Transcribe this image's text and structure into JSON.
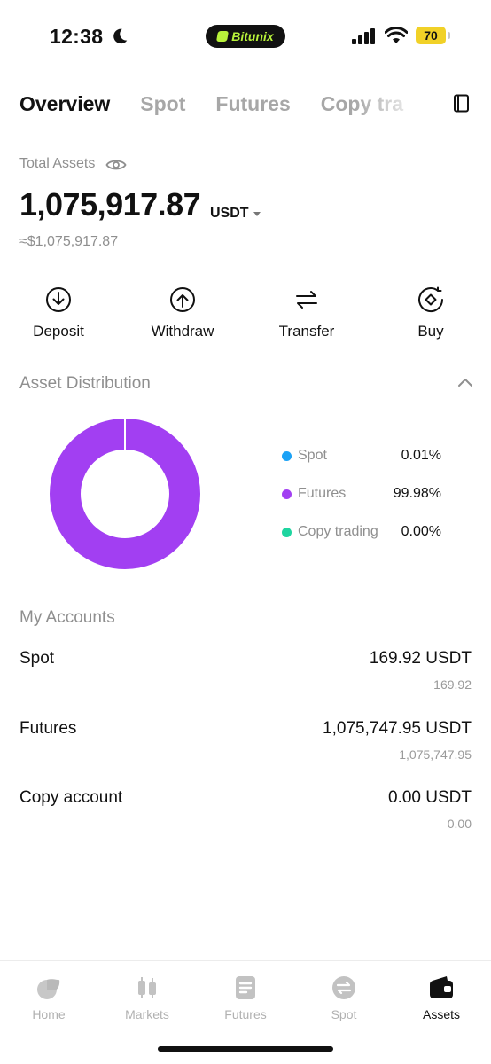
{
  "status": {
    "time": "12:38",
    "island_text": "Bitunix",
    "battery": "70"
  },
  "tabs": [
    {
      "label": "Overview",
      "active": true
    },
    {
      "label": "Spot"
    },
    {
      "label": "Futures"
    },
    {
      "label": "Copy tra"
    }
  ],
  "total": {
    "label": "Total Assets",
    "value": "1,075,917.87",
    "unit": "USDT",
    "fiat": "≈$1,075,917.87"
  },
  "actions": [
    {
      "label": "Deposit",
      "icon": "deposit-icon"
    },
    {
      "label": "Withdraw",
      "icon": "withdraw-icon"
    },
    {
      "label": "Transfer",
      "icon": "transfer-icon"
    },
    {
      "label": "Buy",
      "icon": "buy-icon"
    }
  ],
  "distribution": {
    "title": "Asset Distribution",
    "items": [
      {
        "name": "Spot",
        "value": "0.01%",
        "color": "#1ba2f6"
      },
      {
        "name": "Futures",
        "value": "99.98%",
        "color": "#a23ff2"
      },
      {
        "name": "Copy trading",
        "value": "0.00%",
        "color": "#1fd5a0"
      }
    ],
    "donut_color": "#a23ff2"
  },
  "accounts": {
    "title": "My Accounts",
    "items": [
      {
        "name": "Spot",
        "value": "169.92 USDT",
        "sub": "169.92"
      },
      {
        "name": "Futures",
        "value": "1,075,747.95 USDT",
        "sub": "1,075,747.95"
      },
      {
        "name": "Copy account",
        "value": "0.00 USDT",
        "sub": "0.00"
      }
    ]
  },
  "nav": [
    {
      "label": "Home",
      "icon": "home-icon"
    },
    {
      "label": "Markets",
      "icon": "markets-icon"
    },
    {
      "label": "Futures",
      "icon": "futures-icon"
    },
    {
      "label": "Spot",
      "icon": "spot-icon"
    },
    {
      "label": "Assets",
      "icon": "wallet-icon",
      "active": true
    }
  ]
}
